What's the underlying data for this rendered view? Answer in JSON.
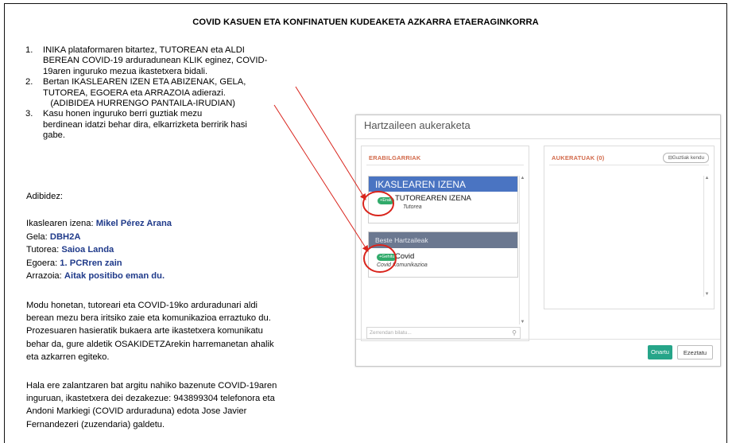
{
  "document": {
    "title": "COVID KASUEN ETA KONFINATUEN KUDEAKETA AZKARRA ETAERAGINKORRA",
    "steps": [
      {
        "num": "1.",
        "lines": [
          "INIKA plataformaren bitartez, TUTOREAN eta ALDI",
          "BEREAN COVID-19 arduradunean KLIK eginez, COVID-",
          "19aren inguruko mezua ikastetxera bidali."
        ]
      },
      {
        "num": "2.",
        "lines": [
          "Bertan IKASLEAREN IZEN ETA ABIZENAK, GELA,",
          "TUTOREA, EGOERA eta ARRAZOIA adierazi.",
          "   (ADIBIDEA HURRENGO PANTAILA-IRUDIAN)"
        ]
      },
      {
        "num": "3.",
        "lines": [
          "Kasu honen inguruko berri guztiak mezu",
          "berdinean idatzi behar dira, elkarrizketa berririk hasi",
          "gabe."
        ]
      }
    ],
    "example_heading": "Adibidez:",
    "example_fields": [
      {
        "label": "Ikaslearen izena: ",
        "value": "Mikel Pérez Arana"
      },
      {
        "label": "Gela: ",
        "value": "DBH2A"
      },
      {
        "label": "Tutorea: ",
        "value": "Saioa Landa"
      },
      {
        "label": "Egoera: ",
        "value": "1. PCRren zain"
      },
      {
        "label": "Arrazoia: ",
        "value": "Aitak positibo eman du."
      }
    ],
    "paragraph1": [
      "Modu honetan, tutoreari eta COVID-19ko arduradunari aldi",
      "berean mezu bera iritsiko zaie eta komunikazioa erraztuko du.",
      "Prozesuaren hasieratik bukaera arte ikastetxera komunikatu",
      "behar da, gure aldetik OSAKIDETZArekin harremanetan ahalik",
      "eta azkarren egiteko."
    ],
    "paragraph2": [
      "Hala ere zalantzaren bat argitu nahiko bazenute COVID-19aren",
      "inguruan, ikastetxera dei dezakezue: 943899304 telefonora eta",
      "Andoni Markiegi (COVID arduraduna) edota Jose Javier",
      "Fernandezeri (zuzendaria) galdetu."
    ]
  },
  "dialog": {
    "title": "Hartzaileen aukeraketa",
    "available_label": "ERABILGARRIAK",
    "selected_label": "AUKERATUAK (0)",
    "remove_all_label": "⊟Guztiak kendu",
    "card1": {
      "header": "IKASLEAREN IZENA",
      "badge": "+Erak",
      "name": "TUTOREAREN IZENA",
      "role": "Tutorea"
    },
    "card2": {
      "header": "Beste Hartzaileak",
      "badge": "+Gehitu",
      "name": "Covid",
      "role": "Covid Komunikazioa"
    },
    "search_placeholder": "Zerrendan bilatu...",
    "ok_label": "Onartu",
    "cancel_label": "Ezeztatu"
  },
  "colors": {
    "accent": "#4a74c2",
    "annotation": "#d9241c",
    "ok": "#26a589",
    "value_text": "#1f3a8a"
  }
}
